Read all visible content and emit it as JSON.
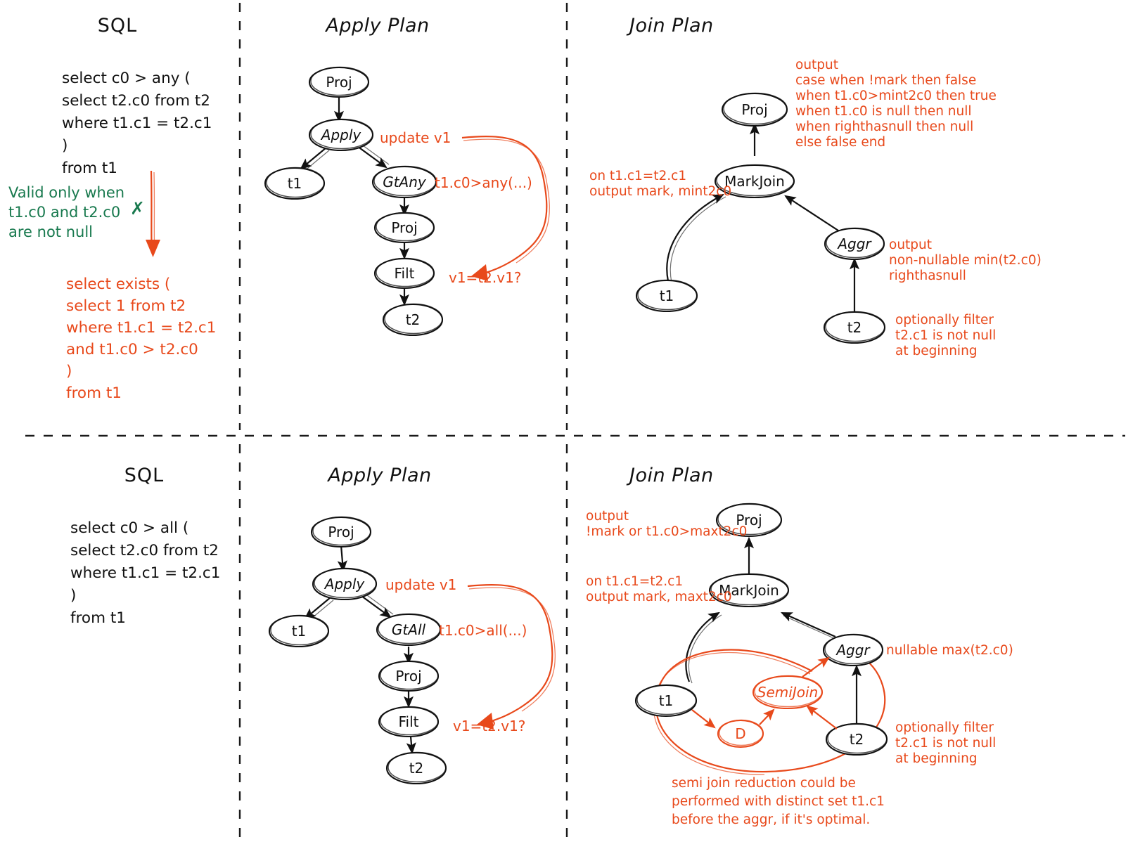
{
  "colors": {
    "ink": "#111111",
    "accent": "#e8491b",
    "valid": "#18794e",
    "paper": "#ffffff"
  },
  "panels": {
    "top_left": {
      "title": "SQL"
    },
    "top_mid": {
      "title": "Apply Plan"
    },
    "top_right": {
      "title": "Join Plan"
    },
    "bot_left": {
      "title": "SQL"
    },
    "bot_mid": {
      "title": "Apply Plan"
    },
    "bot_right": {
      "title": "Join Plan"
    }
  },
  "top_sql": {
    "query_lines": [
      "select c0 > any (",
      "   select t2.c0 from t2",
      "   where t1.c1 = t2.c1",
      ")",
      "from t1"
    ],
    "validity_note": [
      "Valid only when",
      "t1.c0 and t2.c0",
      "are not null"
    ],
    "cross_mark": "✗",
    "rewrite_lines": [
      "select exists (",
      "   select 1 from t2",
      "   where t1.c1 = t2.c1",
      "   and t1.c0 > t2.c0",
      ")",
      "from t1"
    ]
  },
  "bot_sql": {
    "query_lines": [
      "select c0 > all (",
      "   select t2.c0 from t2",
      "   where t1.c1 = t2.c1",
      ")",
      "from t1"
    ]
  },
  "top_apply_plan": {
    "nodes": [
      {
        "id": "proj",
        "label": "Proj",
        "style": "plain"
      },
      {
        "id": "apply",
        "label": "Apply",
        "style": "italic"
      },
      {
        "id": "t1",
        "label": "t1",
        "style": "plain"
      },
      {
        "id": "gtany",
        "label": "GtAny",
        "style": "italic"
      },
      {
        "id": "proj2",
        "label": "Proj",
        "style": "plain"
      },
      {
        "id": "filt",
        "label": "Filt",
        "style": "plain"
      },
      {
        "id": "t2",
        "label": "t2",
        "style": "plain"
      }
    ],
    "annotations": {
      "update": "update v1",
      "predicate": "t1.c0>any(...)",
      "binding": "v1=t2.v1?"
    }
  },
  "bot_apply_plan": {
    "nodes": [
      {
        "id": "proj",
        "label": "Proj",
        "style": "plain"
      },
      {
        "id": "apply",
        "label": "Apply",
        "style": "italic"
      },
      {
        "id": "t1",
        "label": "t1",
        "style": "plain"
      },
      {
        "id": "gtall",
        "label": "GtAll",
        "style": "italic"
      },
      {
        "id": "proj2",
        "label": "Proj",
        "style": "plain"
      },
      {
        "id": "filt",
        "label": "Filt",
        "style": "plain"
      },
      {
        "id": "t2",
        "label": "t2",
        "style": "plain"
      }
    ],
    "annotations": {
      "update": "update v1",
      "predicate": "t1.c0>all(...)",
      "binding": "v1=t2.v1?"
    }
  },
  "top_join_plan": {
    "nodes": [
      {
        "id": "proj",
        "label": "Proj",
        "style": "plain"
      },
      {
        "id": "markjoin",
        "label": "MarkJoin",
        "style": "plain"
      },
      {
        "id": "t1",
        "label": "t1",
        "style": "plain"
      },
      {
        "id": "aggr",
        "label": "Aggr",
        "style": "italic"
      },
      {
        "id": "t2",
        "label": "t2",
        "style": "plain"
      }
    ],
    "proj_output": [
      "output",
      "case when !mark then false",
      "when t1.c0>mint2c0 then true",
      "when t1.c0 is null then null",
      "when righthasnull then null",
      "else false end"
    ],
    "join_note": [
      "on t1.c1=t2.c1",
      "output mark, mint2c0"
    ],
    "aggr_note": [
      "output",
      "non-nullable min(t2.c0)",
      "righthasnull"
    ],
    "filter_note": [
      "optionally filter",
      "t2.c1 is not null",
      "at beginning"
    ]
  },
  "bot_join_plan": {
    "nodes": [
      {
        "id": "proj",
        "label": "Proj",
        "style": "plain"
      },
      {
        "id": "markjoin",
        "label": "MarkJoin",
        "style": "plain"
      },
      {
        "id": "t1",
        "label": "t1",
        "style": "plain"
      },
      {
        "id": "aggr",
        "label": "Aggr",
        "style": "italic"
      },
      {
        "id": "t2",
        "label": "t2",
        "style": "plain"
      },
      {
        "id": "semijoin",
        "label": "SemiJoin",
        "style": "italic-accent"
      },
      {
        "id": "d",
        "label": "D",
        "style": "plain-accent"
      }
    ],
    "proj_output": [
      "output",
      "!mark or t1.c0>maxt2c0"
    ],
    "join_note": [
      "on t1.c1=t2.c1",
      "output mark, maxt2c0"
    ],
    "aggr_note": [
      "nullable max(t2.c0)"
    ],
    "filter_note": [
      "optionally filter",
      "t2.c1 is not null",
      "at beginning"
    ],
    "semijoin_note": [
      "semi join reduction could be",
      "performed with distinct set t1.c1",
      "before the aggr, if it's optimal."
    ]
  }
}
